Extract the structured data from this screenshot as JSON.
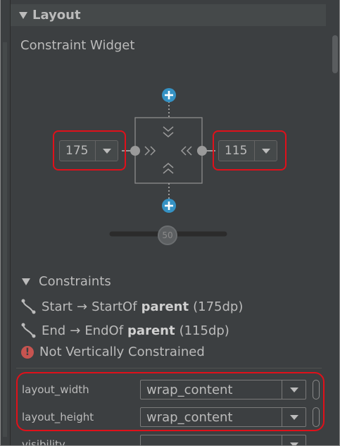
{
  "section": {
    "title": "Layout"
  },
  "widget": {
    "title": "Constraint Widget"
  },
  "left_margin": {
    "value": "175"
  },
  "right_margin": {
    "value": "115"
  },
  "bias_slider": {
    "value": "50"
  },
  "constraints": {
    "header": "Constraints",
    "items": [
      {
        "side": "Start",
        "arrow": "→",
        "target": "StartOf",
        "anchor": "parent",
        "dim": "(175dp)"
      },
      {
        "side": "End",
        "arrow": "→",
        "target": "EndOf",
        "anchor": "parent",
        "dim": "(115dp)"
      }
    ],
    "warning": "Not Vertically Constrained"
  },
  "properties": [
    {
      "label": "layout_width",
      "value": "wrap_content"
    },
    {
      "label": "layout_height",
      "value": "wrap_content"
    },
    {
      "label": "visibility",
      "value": ""
    }
  ],
  "colors": {
    "highlight": "#e0101a",
    "add_button": "#3592c4",
    "background": "#3c3f41",
    "warning": "#c75450"
  },
  "icons": [
    "expand-triangle-icon",
    "add-constraint-icon",
    "constraint-curve-icon",
    "error-icon",
    "chevron-down-icon"
  ]
}
